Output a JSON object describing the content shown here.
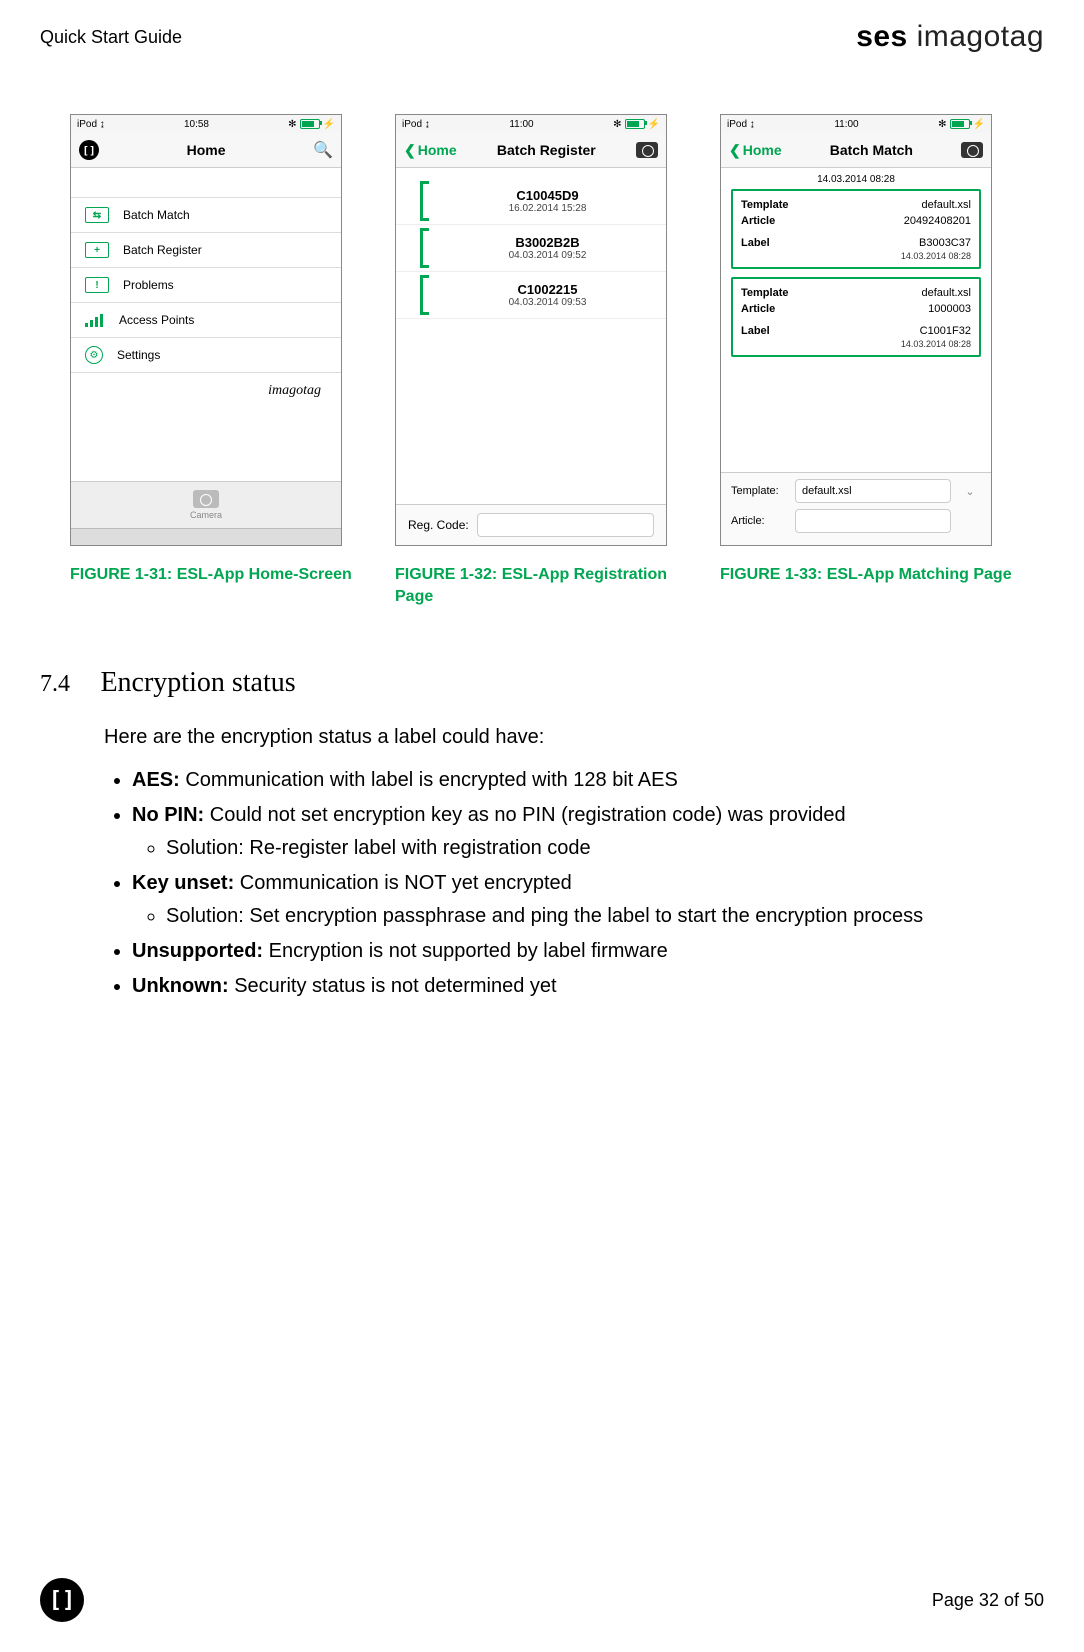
{
  "header": {
    "doc_title": "Quick Start Guide",
    "logo_ses": "ses",
    "logo_imagotag": " imagotag"
  },
  "phones": {
    "home": {
      "status_left": "iPod",
      "status_time": "10:58",
      "nav_title": "Home",
      "menu": [
        "Batch Match",
        "Batch Register",
        "Problems",
        "Access Points",
        "Settings"
      ],
      "brand": "imagotag",
      "cam_label": "Camera"
    },
    "reg": {
      "status_left": "iPod",
      "status_time": "11:00",
      "back": "Home",
      "nav_title": "Batch Register",
      "items": [
        {
          "code": "C10045D9",
          "date": "16.02.2014 15:28"
        },
        {
          "code": "B3002B2B",
          "date": "04.03.2014 09:52"
        },
        {
          "code": "C1002215",
          "date": "04.03.2014 09:53"
        }
      ],
      "foot_label": "Reg. Code:"
    },
    "match": {
      "status_left": "iPod",
      "status_time": "11:00",
      "back": "Home",
      "nav_title": "Batch Match",
      "top_date": "14.03.2014 08:28",
      "blocks": [
        {
          "template": "default.xsl",
          "article": "20492408201",
          "label": "B3003C37",
          "date": "14.03.2014 08:28"
        },
        {
          "template": "default.xsl",
          "article": "1000003",
          "label": "C1001F32",
          "date": "14.03.2014 08:28"
        }
      ],
      "k_template": "Template",
      "k_article": "Article",
      "k_label": "Label",
      "foot_template_label": "Template:",
      "foot_template_value": "default.xsl",
      "foot_article_label": "Article:"
    }
  },
  "captions": {
    "c1": "FIGURE 1-31: ESL-App Home-Screen",
    "c2": "FIGURE 1-32: ESL-App Registration Page",
    "c3": "FIGURE 1-33: ESL-App Matching Page"
  },
  "section": {
    "num": "7.4",
    "title": "Encryption status",
    "intro": "Here are the encryption status a label could have:",
    "b_aes_k": "AES:",
    "b_aes_v": " Communication with label is encrypted with 128 bit AES",
    "b_nopin_k": "No PIN:",
    "b_nopin_v": " Could not set encryption key as no PIN (registration code) was provided",
    "b_nopin_sol": "Solution: Re-register label with registration code",
    "b_key_k": "Key  unset:",
    "b_key_v": " Communication is NOT yet encrypted",
    "b_key_sol": "Solution: Set encryption passphrase and ping the label to start the encryption process",
    "b_unsup_k": "Unsupported:",
    "b_unsup_v": " Encryption is not supported by label firmware",
    "b_unk_k": "Unknown:",
    "b_unk_v": " Security status is not determined yet"
  },
  "footer": {
    "page": "Page 32 of 50",
    "logo": "[]"
  }
}
